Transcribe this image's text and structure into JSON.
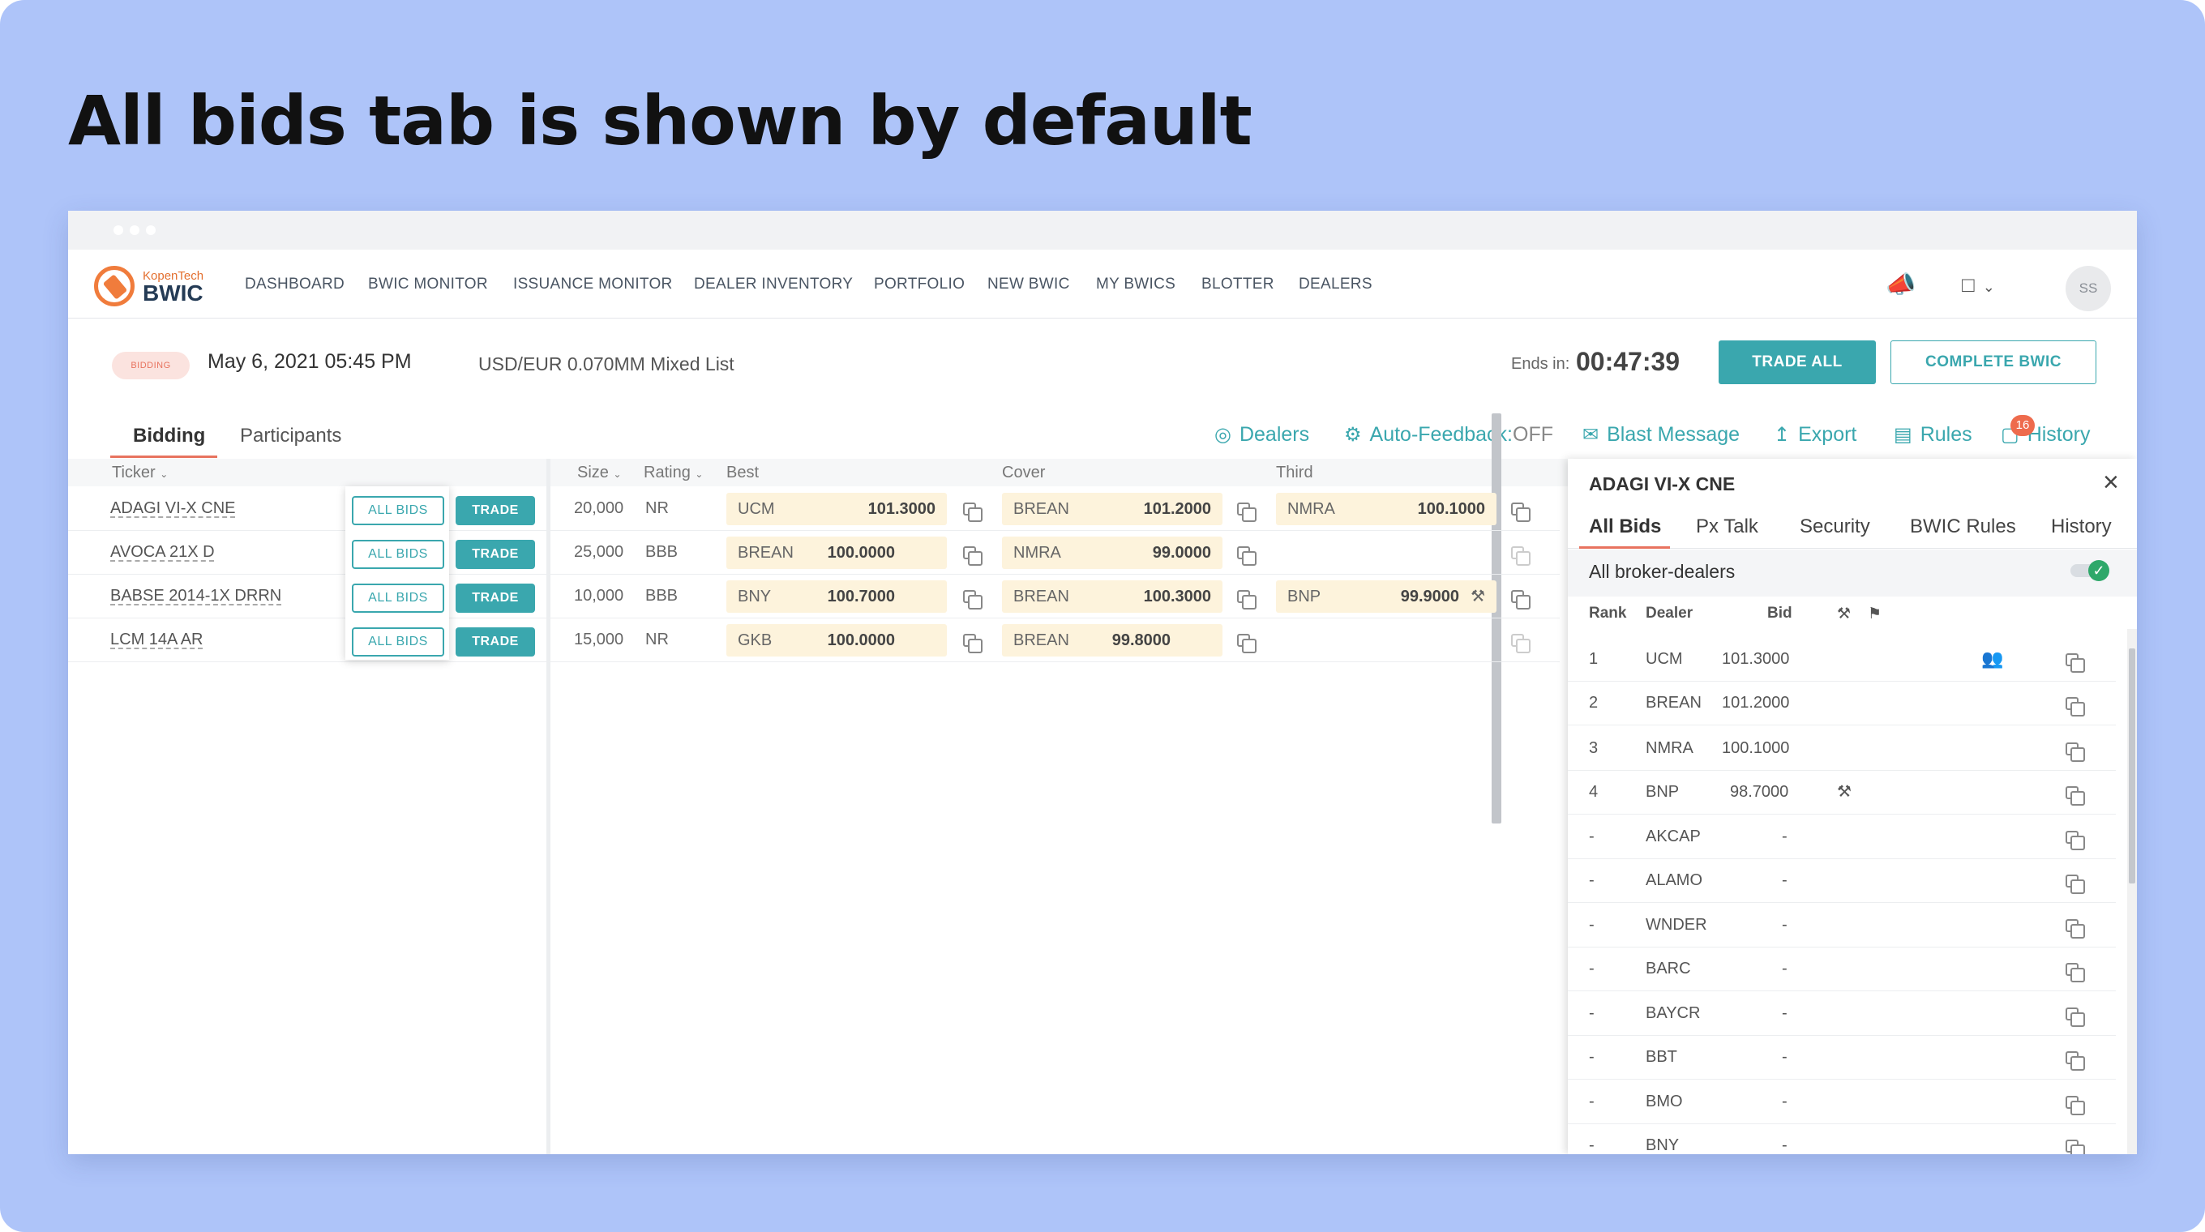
{
  "slide": {
    "title": "All bids tab is shown by default"
  },
  "nav": {
    "logo_top": "KopenTech",
    "logo_main": "BWIC",
    "items": [
      "DASHBOARD",
      "BWIC MONITOR",
      "ISSUANCE MONITOR",
      "DEALER INVENTORY",
      "PORTFOLIO",
      "NEW BWIC",
      "MY BWICS",
      "BLOTTER",
      "DEALERS"
    ],
    "avatar": "SS"
  },
  "header": {
    "status": "BIDDING",
    "date": "May 6, 2021 05:45 PM",
    "list": "USD/EUR 0.070MM Mixed List",
    "ends_label": "Ends in:",
    "ends_time": "00:47:39",
    "trade_all": "TRADE ALL",
    "complete": "COMPLETE BWIC"
  },
  "tabs": {
    "bidding": "Bidding",
    "participants": "Participants"
  },
  "toolbar": {
    "dealers": "Dealers",
    "autofeedback": "Auto-Feedback:",
    "autofeedback_state": "OFF",
    "blast": "Blast Message",
    "export": "Export",
    "rules": "Rules",
    "history": "History",
    "history_count": "16"
  },
  "columns": {
    "ticker": "Ticker",
    "size": "Size",
    "rating": "Rating",
    "best": "Best",
    "cover": "Cover",
    "third": "Third"
  },
  "buttons": {
    "all_bids": "ALL BIDS",
    "trade": "TRADE"
  },
  "rows": [
    {
      "ticker": "ADAGI VI-X CNE",
      "size": "20,000",
      "rating": "NR",
      "best_dealer": "UCM",
      "best_px": "101.3000",
      "cover_dealer": "BREAN",
      "cover_px": "101.2000",
      "third_dealer": "NMRA",
      "third_px": "100.1000"
    },
    {
      "ticker": "AVOCA 21X D",
      "size": "25,000",
      "rating": "BBB",
      "best_dealer": "BREAN",
      "best_px": "100.0000",
      "cover_dealer": "NMRA",
      "cover_px": "99.0000",
      "third_dealer": "",
      "third_px": ""
    },
    {
      "ticker": "BABSE 2014-1X DRRN",
      "size": "10,000",
      "rating": "BBB",
      "best_dealer": "BNY",
      "best_px": "100.7000",
      "cover_dealer": "BREAN",
      "cover_px": "100.3000",
      "third_dealer": "BNP",
      "third_px": "99.9000"
    },
    {
      "ticker": "LCM 14A AR",
      "size": "15,000",
      "rating": "NR",
      "best_dealer": "GKB",
      "best_px": "100.0000",
      "cover_dealer": "BREAN",
      "cover_px": "99.8000",
      "third_dealer": "",
      "third_px": ""
    }
  ],
  "panel": {
    "title": "ADAGI VI-X CNE",
    "tabs": [
      "All Bids",
      "Px Talk",
      "Security",
      "BWIC Rules",
      "History"
    ],
    "group": "All broker-dealers",
    "headers": {
      "rank": "Rank",
      "dealer": "Dealer",
      "bid": "Bid"
    },
    "bids": [
      {
        "rank": "1",
        "dealer": "UCM",
        "bid": "101.3000"
      },
      {
        "rank": "2",
        "dealer": "BREAN",
        "bid": "101.2000"
      },
      {
        "rank": "3",
        "dealer": "NMRA",
        "bid": "100.1000"
      },
      {
        "rank": "4",
        "dealer": "BNP",
        "bid": "98.7000"
      },
      {
        "rank": "-",
        "dealer": "AKCAP",
        "bid": "-"
      },
      {
        "rank": "-",
        "dealer": "ALAMO",
        "bid": "-"
      },
      {
        "rank": "-",
        "dealer": "WNDER",
        "bid": "-"
      },
      {
        "rank": "-",
        "dealer": "BARC",
        "bid": "-"
      },
      {
        "rank": "-",
        "dealer": "BAYCR",
        "bid": "-"
      },
      {
        "rank": "-",
        "dealer": "BBT",
        "bid": "-"
      },
      {
        "rank": "-",
        "dealer": "BMO",
        "bid": "-"
      },
      {
        "rank": "-",
        "dealer": "BNY",
        "bid": "-"
      }
    ]
  },
  "colors": {
    "accent": "#3aa7ae",
    "alert": "#e8735f",
    "background": "#aec4f9"
  }
}
